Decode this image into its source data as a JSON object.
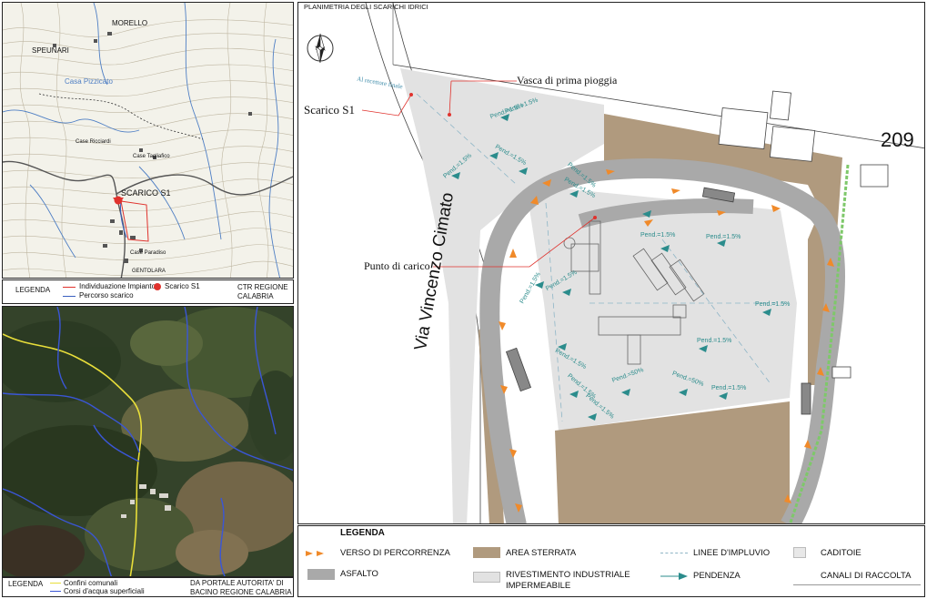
{
  "ctr_map": {
    "place_labels": [
      "MORELLO",
      "SPEUNARI",
      "Casa Pizzicato",
      "SCARICO S1",
      "Case Tagliafico",
      "Case Paradiso",
      "Case Ricciardi",
      "GENTOLARA"
    ],
    "legend": {
      "title": "LEGENDA",
      "impianto": "Individuazione Impianto",
      "percorso": "Percorso scarico",
      "scarico": "Scarico S1",
      "source": "CTR REGIONE CALABRIA"
    }
  },
  "aerial_map": {
    "legend": {
      "title": "LEGENDA",
      "confini": "Confini comunali",
      "corsi": "Corsi d'acqua superficiali",
      "source": "DA PORTALE AUTORITA' DI BACINO REGIONE CALABRIA"
    }
  },
  "plan": {
    "title": "PLANIMETRIA DEGLI SCARICHI IDRICI",
    "street": "Via Vincenzo Cimato",
    "parcel": "209",
    "labels": {
      "scarico": "Scarico S1",
      "vasca": "Vasca di prima pioggia",
      "punto": "Punto di carico",
      "recettore": "Al recettore finale"
    },
    "slopes": [
      "Pend.=1.5%",
      "Pend.=1.5%",
      "Pend.=1.5%",
      "Pend.=1.5%",
      "Pend.=1.5%",
      "Pend.=1.5%",
      "Pend.=1.5%",
      "Pend.=1.5%",
      "Pend.=1.5%",
      "Pend.=1.5%",
      "Pend.=1.5%",
      "Pend.=1.5%",
      "Pend.=1.5%",
      "Pend.=1.5%",
      "Pend.=1.5%",
      "Pend.=50%",
      "Pend.=50%",
      "Pend.=1.5%"
    ],
    "legend": {
      "title": "LEGENDA",
      "verso": "VERSO DI PERCORRENZA",
      "asfalto": "ASFALTO",
      "sterrata": "AREA STERRATA",
      "rivestimento": "RIVESTIMENTO INDUSTRIALE IMPERMEABILE",
      "impluvio": "LINEE D'IMPLUVIO",
      "pendenza": "PENDENZA",
      "caditoie": "CADITOIE",
      "canali": "CANALI DI RACCOLTA"
    },
    "colors": {
      "asphalt": "#a9a9a9",
      "dirt": "#b09a7e",
      "coating": "#e2e2e2",
      "arrow": "#f08a2a",
      "slope": "#2b8c8c",
      "canal": "#7ec86a",
      "scarico": "#e0322d"
    }
  }
}
